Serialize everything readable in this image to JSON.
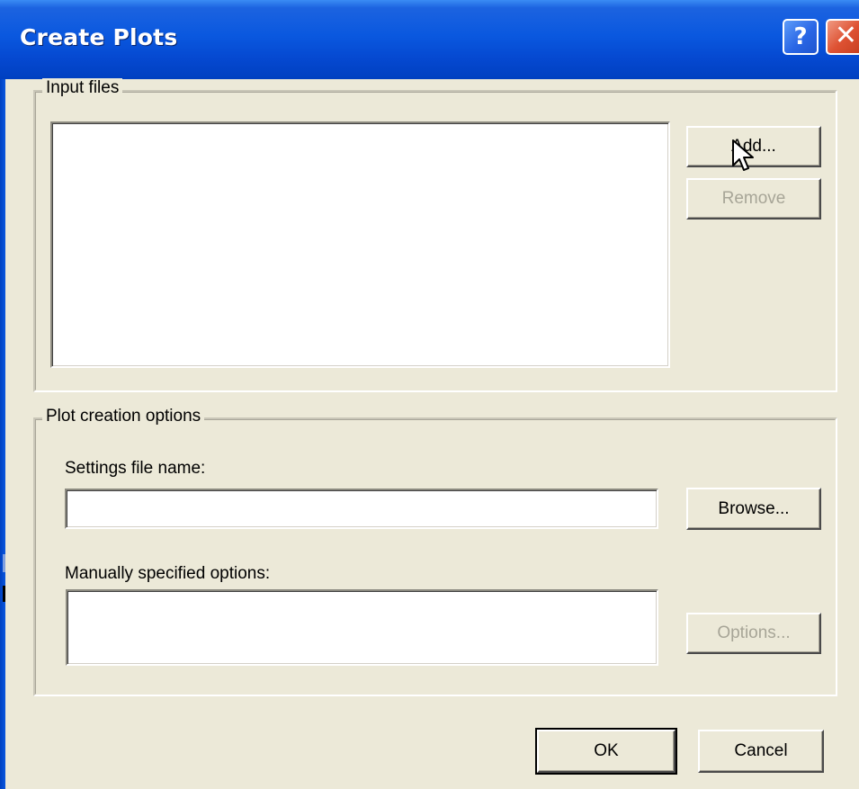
{
  "window": {
    "title": "Create Plots",
    "help_glyph": "?",
    "close_glyph": "✕"
  },
  "input_files": {
    "legend": "Input files",
    "add_label": "Add...",
    "remove_label": "Remove"
  },
  "plot_options": {
    "legend": "Plot creation options",
    "settings_label": "Settings file name:",
    "settings_value": "",
    "browse_label": "Browse...",
    "manual_label": "Manually specified options:",
    "manual_value": "",
    "options_label": "Options..."
  },
  "footer": {
    "ok_label": "OK",
    "cancel_label": "Cancel"
  },
  "colors": {
    "title_bar": "#0a58df",
    "close_button": "#de5233",
    "dialog_bg": "#ece9d8",
    "disabled_text": "#a7a597"
  },
  "icons": {
    "help": "help-icon",
    "close": "close-icon",
    "cursor": "mouse-pointer-icon"
  }
}
